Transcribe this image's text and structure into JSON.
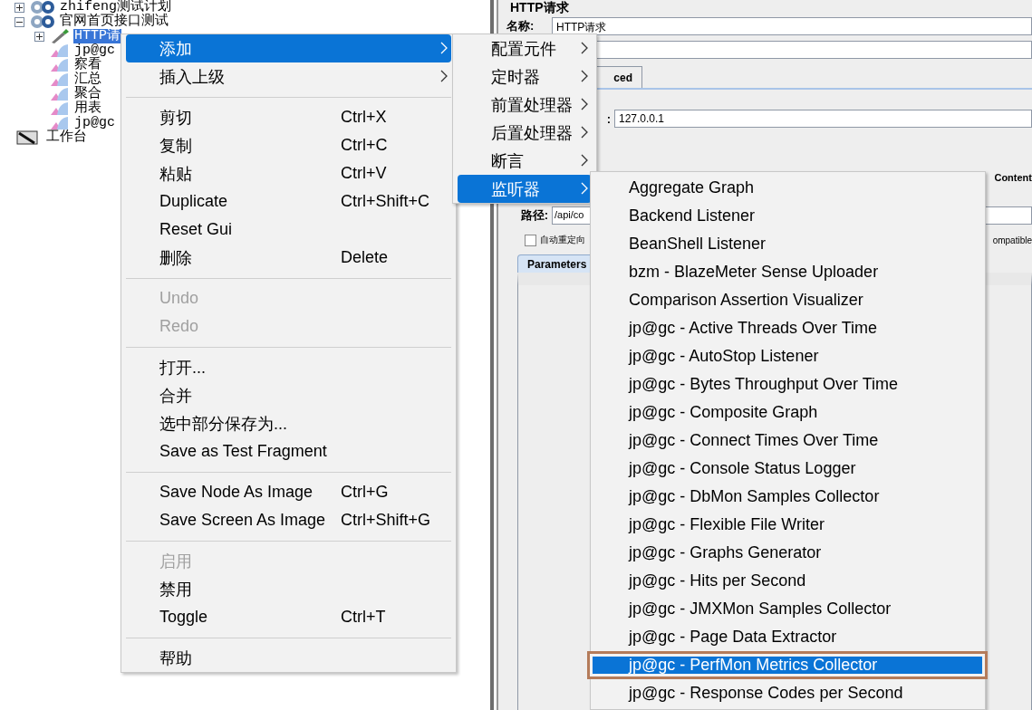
{
  "tree": {
    "items": [
      {
        "kind": "plan",
        "label": "zhifeng测试计划",
        "expanded": false,
        "selected": false
      },
      {
        "kind": "thread",
        "label": "官网首页接口测试",
        "expanded": true,
        "selected": false,
        "children": [
          {
            "kind": "sampler",
            "label": "HTTP请",
            "expanded": false,
            "selected": true
          },
          {
            "kind": "listener",
            "label": "jp@gc",
            "selected": false
          },
          {
            "kind": "listener",
            "label": "察看",
            "selected": false
          },
          {
            "kind": "listener",
            "label": "汇总",
            "selected": false
          },
          {
            "kind": "listener",
            "label": "聚合",
            "selected": false
          },
          {
            "kind": "listener",
            "label": "用表",
            "selected": false
          },
          {
            "kind": "listener",
            "label": "jp@gc",
            "selected": false
          }
        ]
      },
      {
        "kind": "workbench",
        "label": "工作台",
        "selected": false
      }
    ]
  },
  "editor": {
    "title": "HTTP请求",
    "name_label": "名称:",
    "name_value": "HTTP请求",
    "tab_partial": "ced",
    "server_label": ":",
    "server_value": "127.0.0.1",
    "content_label": "Content",
    "path_label": "路径:",
    "path_value": "/api/co",
    "redirect": {
      "label": "自动重定向",
      "checked": false
    },
    "compatible_partial": "ompatible",
    "params_tab": "Parameters"
  },
  "context_menu": {
    "items": [
      {
        "kind": "item",
        "label": "添加",
        "submenu": true,
        "selected": true,
        "disabled": false
      },
      {
        "kind": "item",
        "label": "插入上级",
        "submenu": true,
        "selected": false,
        "disabled": false
      },
      {
        "kind": "separator"
      },
      {
        "kind": "item",
        "label": "剪切",
        "shortcut": "Ctrl+X",
        "selected": false,
        "disabled": false
      },
      {
        "kind": "item",
        "label": "复制",
        "shortcut": "Ctrl+C",
        "selected": false,
        "disabled": false
      },
      {
        "kind": "item",
        "label": "粘贴",
        "shortcut": "Ctrl+V",
        "selected": false,
        "disabled": false
      },
      {
        "kind": "item",
        "label": "Duplicate",
        "shortcut": "Ctrl+Shift+C",
        "selected": false,
        "disabled": false
      },
      {
        "kind": "item",
        "label": "Reset Gui",
        "selected": false,
        "disabled": false
      },
      {
        "kind": "item",
        "label": "删除",
        "shortcut": "Delete",
        "selected": false,
        "disabled": false
      },
      {
        "kind": "separator"
      },
      {
        "kind": "item",
        "label": "Undo",
        "selected": false,
        "disabled": true
      },
      {
        "kind": "item",
        "label": "Redo",
        "selected": false,
        "disabled": true
      },
      {
        "kind": "separator"
      },
      {
        "kind": "item",
        "label": "打开...",
        "selected": false,
        "disabled": false
      },
      {
        "kind": "item",
        "label": "合并",
        "selected": false,
        "disabled": false
      },
      {
        "kind": "item",
        "label": "选中部分保存为...",
        "selected": false,
        "disabled": false
      },
      {
        "kind": "item",
        "label": "Save as Test Fragment",
        "selected": false,
        "disabled": false
      },
      {
        "kind": "separator"
      },
      {
        "kind": "item",
        "label": "Save Node As Image",
        "shortcut": "Ctrl+G",
        "selected": false,
        "disabled": false
      },
      {
        "kind": "item",
        "label": "Save Screen As Image",
        "shortcut": "Ctrl+Shift+G",
        "selected": false,
        "disabled": false
      },
      {
        "kind": "separator"
      },
      {
        "kind": "item",
        "label": "启用",
        "selected": false,
        "disabled": true
      },
      {
        "kind": "item",
        "label": "禁用",
        "selected": false,
        "disabled": false
      },
      {
        "kind": "item",
        "label": "Toggle",
        "shortcut": "Ctrl+T",
        "selected": false,
        "disabled": false
      },
      {
        "kind": "separator"
      },
      {
        "kind": "item",
        "label": "帮助",
        "selected": false,
        "disabled": false
      }
    ]
  },
  "add_submenu": {
    "items": [
      {
        "label": "配置元件",
        "selected": false
      },
      {
        "label": "定时器",
        "selected": false
      },
      {
        "label": "前置处理器",
        "selected": false
      },
      {
        "label": "后置处理器",
        "selected": false
      },
      {
        "label": "断言",
        "selected": false
      },
      {
        "label": "监听器",
        "selected": true
      }
    ]
  },
  "listener_submenu": {
    "items": [
      {
        "label": "Aggregate Graph",
        "selected": false,
        "outlined": false
      },
      {
        "label": "Backend Listener",
        "selected": false,
        "outlined": false
      },
      {
        "label": "BeanShell Listener",
        "selected": false,
        "outlined": false
      },
      {
        "label": "bzm - BlazeMeter Sense Uploader",
        "selected": false,
        "outlined": false
      },
      {
        "label": "Comparison Assertion Visualizer",
        "selected": false,
        "outlined": false
      },
      {
        "label": "jp@gc - Active Threads Over Time",
        "selected": false,
        "outlined": false
      },
      {
        "label": "jp@gc - AutoStop Listener",
        "selected": false,
        "outlined": false
      },
      {
        "label": "jp@gc - Bytes Throughput Over Time",
        "selected": false,
        "outlined": false
      },
      {
        "label": "jp@gc - Composite Graph",
        "selected": false,
        "outlined": false
      },
      {
        "label": "jp@gc - Connect Times Over Time",
        "selected": false,
        "outlined": false
      },
      {
        "label": "jp@gc - Console Status Logger",
        "selected": false,
        "outlined": false
      },
      {
        "label": "jp@gc - DbMon Samples Collector",
        "selected": false,
        "outlined": false
      },
      {
        "label": "jp@gc - Flexible File Writer",
        "selected": false,
        "outlined": false
      },
      {
        "label": "jp@gc - Graphs Generator",
        "selected": false,
        "outlined": false
      },
      {
        "label": "jp@gc - Hits per Second",
        "selected": false,
        "outlined": false
      },
      {
        "label": "jp@gc - JMXMon Samples Collector",
        "selected": false,
        "outlined": false
      },
      {
        "label": "jp@gc - Page Data Extractor",
        "selected": false,
        "outlined": false
      },
      {
        "label": "jp@gc - PerfMon Metrics Collector",
        "selected": true,
        "outlined": true
      },
      {
        "label": "jp@gc - Response Codes per Second",
        "selected": false,
        "outlined": false
      }
    ]
  }
}
